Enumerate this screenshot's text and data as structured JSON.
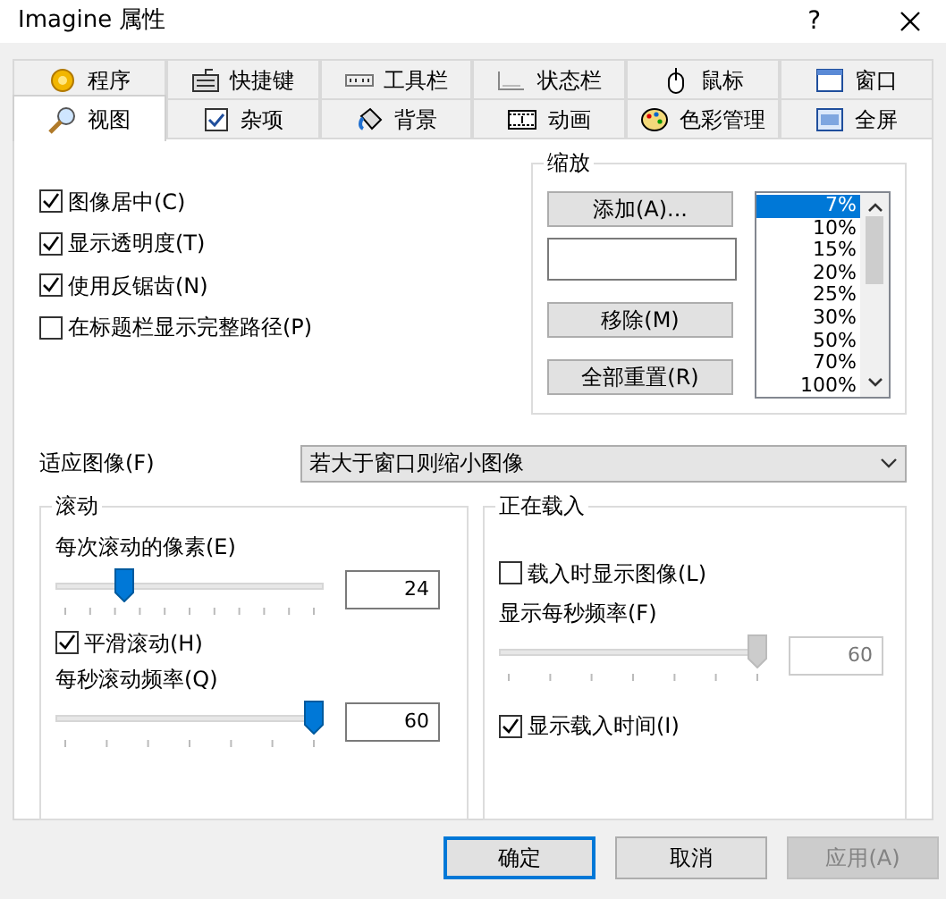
{
  "window": {
    "title": "Imagine 属性",
    "help": "?"
  },
  "tab_rows": [
    [
      {
        "label": "程序",
        "selected": false
      },
      {
        "label": "快捷键",
        "selected": false
      },
      {
        "label": "工具栏",
        "selected": false
      },
      {
        "label": "状态栏",
        "selected": false
      },
      {
        "label": "鼠标",
        "selected": false
      },
      {
        "label": "窗口",
        "selected": false
      }
    ],
    [
      {
        "label": "视图",
        "selected": true
      },
      {
        "label": "杂项",
        "selected": false
      },
      {
        "label": "背景",
        "selected": false
      },
      {
        "label": "动画",
        "selected": false
      },
      {
        "label": "色彩管理",
        "selected": false
      },
      {
        "label": "全屏",
        "selected": false
      }
    ]
  ],
  "options": [
    {
      "label": "图像居中(C)",
      "checked": true
    },
    {
      "label": "显示透明度(T)",
      "checked": true
    },
    {
      "label": "使用反锯齿(N)",
      "checked": true
    },
    {
      "label": "在标题栏显示完整路径(P)",
      "checked": false
    }
  ],
  "zoom": {
    "title": "缩放",
    "add": "添加(A)...",
    "remove": "移除(M)",
    "reset": "全部重置(R)",
    "list": [
      {
        "label": "7%",
        "selected": true
      },
      {
        "label": "10%",
        "selected": false
      },
      {
        "label": "15%",
        "selected": false
      },
      {
        "label": "20%",
        "selected": false
      },
      {
        "label": "25%",
        "selected": false
      },
      {
        "label": "30%",
        "selected": false
      },
      {
        "label": "50%",
        "selected": false
      },
      {
        "label": "70%",
        "selected": false
      },
      {
        "label": "100%",
        "selected": false
      }
    ]
  },
  "fit": {
    "label": "适应图像(F)",
    "value": "若大于窗口则缩小图像"
  },
  "scroll": {
    "title": "滚动",
    "pixels": {
      "label": "每次滚动的像素(E)",
      "level": 0.24,
      "value": "24",
      "disabled": false
    },
    "smooth": {
      "label": "平滑滚动(H)",
      "checked": true
    },
    "rate": {
      "label": "每秒滚动频率(Q)",
      "level": 1,
      "value": "60",
      "disabled": false
    }
  },
  "loading": {
    "title": "正在载入",
    "show": {
      "label": "载入时显示图像(L)",
      "checked": false
    },
    "fps": {
      "label": "显示每秒频率(F)",
      "level": 1,
      "value": "60",
      "disabled": true
    },
    "show_time": {
      "label": "显示载入时间(I)",
      "checked": true
    }
  },
  "buttons": [
    {
      "label": "确定",
      "kind": "default"
    },
    {
      "label": "取消",
      "kind": "normal"
    },
    {
      "label": "应用(A)",
      "kind": "disabled"
    }
  ]
}
